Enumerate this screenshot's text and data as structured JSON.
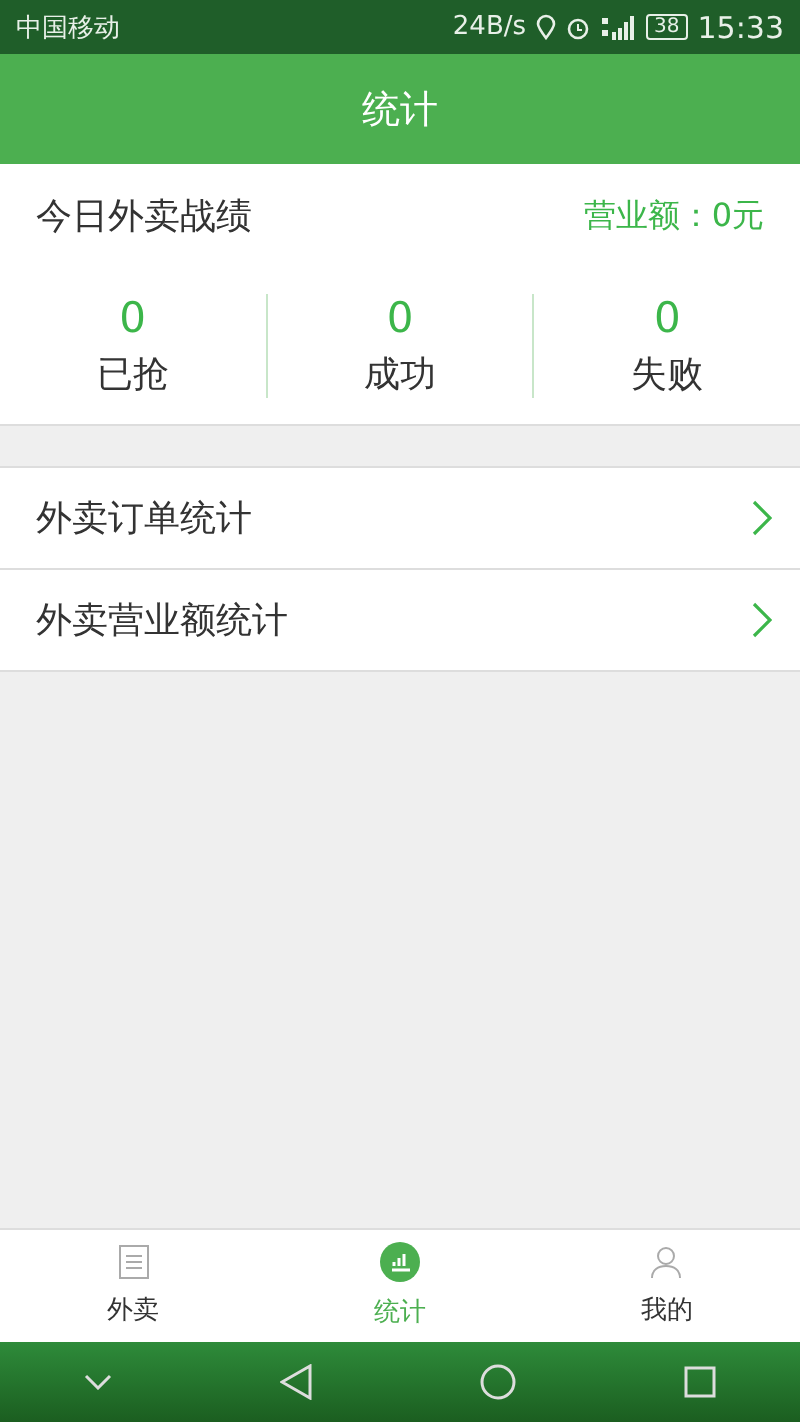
{
  "status_bar": {
    "carrier": "中国移动",
    "speed": "24B/s",
    "battery": "38",
    "time": "15:33"
  },
  "header": {
    "title": "统计"
  },
  "summary": {
    "title": "今日外卖战绩",
    "revenue": "营业额：0元",
    "stats": [
      {
        "value": "0",
        "label": "已抢"
      },
      {
        "value": "0",
        "label": "成功"
      },
      {
        "value": "0",
        "label": "失败"
      }
    ]
  },
  "menu": [
    {
      "label": "外卖订单统计"
    },
    {
      "label": "外卖营业额统计"
    }
  ],
  "tabs": [
    {
      "label": "外卖",
      "kind": "orders",
      "selected": false
    },
    {
      "label": "统计",
      "kind": "stats",
      "selected": true
    },
    {
      "label": "我的",
      "kind": "profile",
      "selected": false
    }
  ]
}
